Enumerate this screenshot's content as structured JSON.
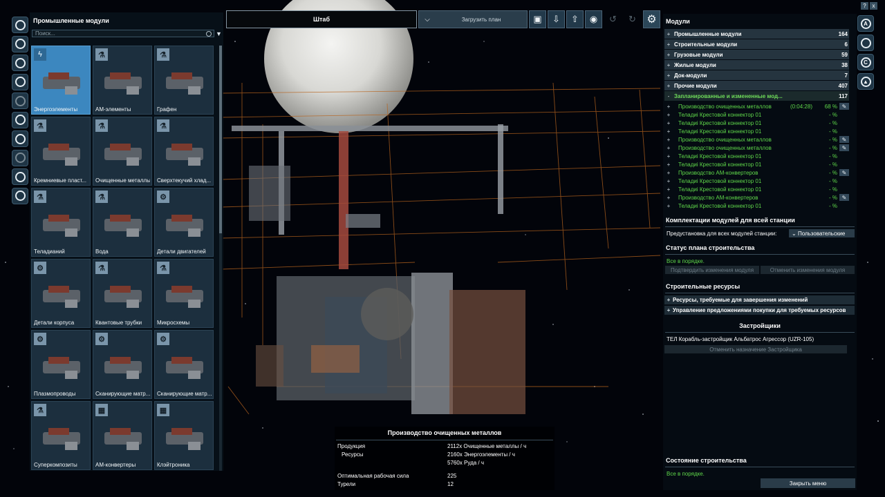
{
  "left_panel": {
    "title": "Промышленные модули",
    "search_placeholder": "Поиск...",
    "tiles": [
      {
        "label": "Энергоэлементы",
        "icon": "bolt-icon",
        "selected": true
      },
      {
        "label": "АМ-элементы",
        "icon": "flask-icon"
      },
      {
        "label": "Графен",
        "icon": "flask-icon"
      },
      {
        "label": "Кремниевые пласт...",
        "icon": "flask-icon"
      },
      {
        "label": "Очищенные металлы",
        "icon": "flask-icon"
      },
      {
        "label": "Сверхтекучий хлад...",
        "icon": "flask-icon"
      },
      {
        "label": "Теладианий",
        "icon": "flask-icon"
      },
      {
        "label": "Вода",
        "icon": "flask-icon"
      },
      {
        "label": "Детали двигателей",
        "icon": "gear-icon"
      },
      {
        "label": "Детали корпуса",
        "icon": "gear-icon"
      },
      {
        "label": "Квантовые трубки",
        "icon": "flask-icon"
      },
      {
        "label": "Микросхемы",
        "icon": "flask-icon"
      },
      {
        "label": "Плазмопроводы",
        "icon": "gear-icon"
      },
      {
        "label": "Сканирующие матр...",
        "icon": "gear-icon"
      },
      {
        "label": "Сканирующие матр...",
        "icon": "gear-icon"
      },
      {
        "label": "Суперкомпозиты",
        "icon": "flask-icon"
      },
      {
        "label": "АМ-конвертеры",
        "icon": "chip-icon"
      },
      {
        "label": "Клэйтроника",
        "icon": "chip-icon"
      }
    ]
  },
  "toolbar": {
    "hq_label": "Штаб",
    "load_plan_label": "Загрузить план"
  },
  "top_right_buttons": [
    "?",
    "x"
  ],
  "right_panel": {
    "title": "Модули",
    "categories": [
      {
        "name": "Промышленные модули",
        "count": "164"
      },
      {
        "name": "Строительные модули",
        "count": "6"
      },
      {
        "name": "Грузовые модули",
        "count": "59"
      },
      {
        "name": "Жилые модули",
        "count": "38"
      },
      {
        "name": "Док-модули",
        "count": "7"
      },
      {
        "name": "Прочие модули",
        "count": "407"
      }
    ],
    "planned": {
      "name": "Запланированные и измененные мод...",
      "count": "117"
    },
    "planned_items": [
      {
        "name": "Производство очищенных металлов",
        "time": "(0:04:28)",
        "pct": "68 %",
        "edit": true
      },
      {
        "name": "Теладиi Крестовой коннектор 01",
        "time": "",
        "pct": "- %",
        "edit": false
      },
      {
        "name": "Теладиi Крестовой коннектор 01",
        "time": "",
        "pct": "- %",
        "edit": false
      },
      {
        "name": "Теладиi Крестовой коннектор 01",
        "time": "",
        "pct": "- %",
        "edit": false
      },
      {
        "name": "Производство очищенных металлов",
        "time": "",
        "pct": "- %",
        "edit": true
      },
      {
        "name": "Производство очищенных металлов",
        "time": "",
        "pct": "- %",
        "edit": true
      },
      {
        "name": "Теладиi Крестовой коннектор 01",
        "time": "",
        "pct": "- %",
        "edit": false
      },
      {
        "name": "Теладиi Крестовой коннектор 01",
        "time": "",
        "pct": "- %",
        "edit": false
      },
      {
        "name": "Производство АМ-конвертеров",
        "time": "",
        "pct": "- %",
        "edit": true
      },
      {
        "name": "Теладиi Крестовой коннектор 01",
        "time": "",
        "pct": "- %",
        "edit": false
      },
      {
        "name": "Теладиi Крестовой коннектор 01",
        "time": "",
        "pct": "- %",
        "edit": false
      },
      {
        "name": "Производство АМ-конвертеров",
        "time": "",
        "pct": "- %",
        "edit": true
      },
      {
        "name": "Теладиi Крестовой коннектор 01",
        "time": "",
        "pct": "- %",
        "edit": false
      }
    ],
    "equipment_heading": "Комплектации модулей для всей станции",
    "preset_label": "Предустановка для всех модулей станции:",
    "preset_value": "Пользовательские",
    "plan_status_heading": "Статус плана строительства",
    "plan_status_text": "Все в порядке.",
    "confirm_label": "Подтвердить изменения модуля",
    "cancel_label": "Отменить изменения модуля",
    "resources_heading": "Строительные ресурсы",
    "resources_rows": [
      "Ресурсы, требуемые для завершения изменений",
      "Управление предложениями покупки для требуемых ресурсов"
    ],
    "builders_heading": "Застройщики",
    "builder_name": "ТЕЛ Корабль-застройщик Альбатрос Агрессор (UZR-105)",
    "unassign_label": "Отменить назначение Застройщика",
    "construction_heading": "Состояние строительства",
    "construction_text": "Все в порядке.",
    "close_label": "Закрыть меню"
  },
  "right_bar": [
    "A",
    "",
    "C",
    "▲"
  ],
  "info_panel": {
    "title": "Производство очищенных металлов",
    "product_label": "Продукция",
    "product_value": "2112x Очищенные металлы / ч",
    "resources_label": "Ресурсы",
    "resources_values": [
      "2160x Энергоэлементы / ч",
      "5760x Руда / ч"
    ],
    "workforce_label": "Оптимальная рабочая сила",
    "workforce_value": "225",
    "turrets_label": "Турели",
    "turrets_value": "12"
  },
  "colors": {
    "accent_green": "#5fd84a",
    "selected_tile": "#3c87bf",
    "panel_bg": "#08121a",
    "grid_orange": "#b8641e"
  }
}
